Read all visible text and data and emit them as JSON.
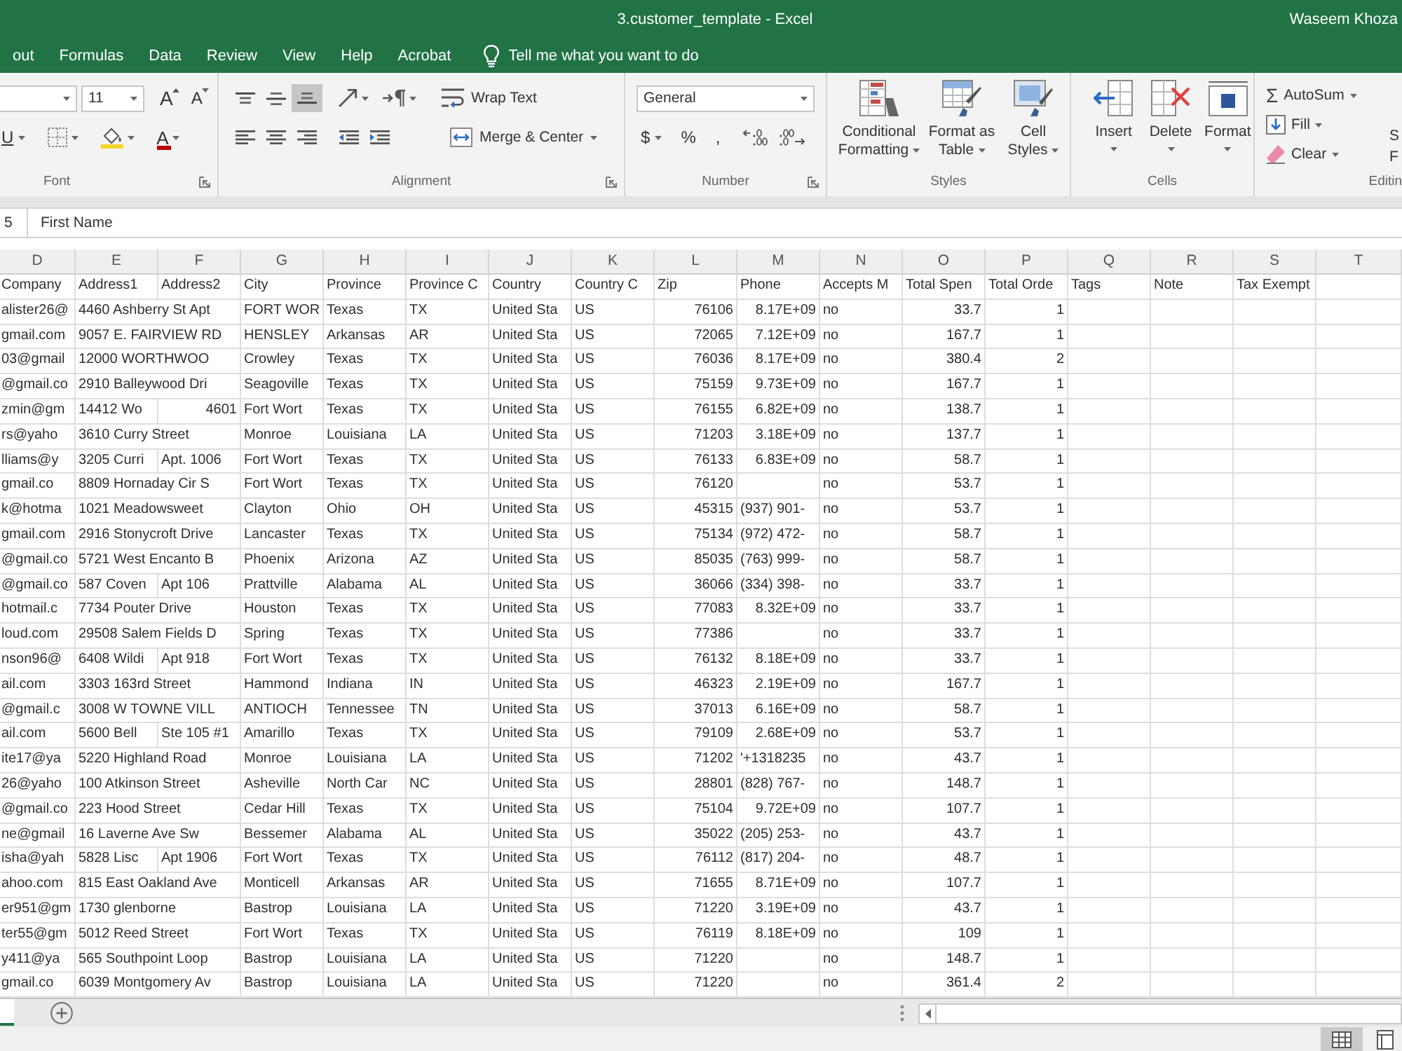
{
  "window": {
    "title": "3.customer_template - Excel",
    "user": "Waseem Khoza"
  },
  "tabs": [
    {
      "label": "out",
      "selected": false
    },
    {
      "label": "Formulas",
      "selected": false
    },
    {
      "label": "Data",
      "selected": false
    },
    {
      "label": "Review",
      "selected": false
    },
    {
      "label": "View",
      "selected": false
    },
    {
      "label": "Help",
      "selected": false
    },
    {
      "label": "Acrobat",
      "selected": false
    }
  ],
  "tell_me": {
    "placeholder": "Tell me what you want to do"
  },
  "ribbon": {
    "font": {
      "label": "Font",
      "size": "11",
      "grow": "A",
      "shrink": "A",
      "underline": "U",
      "font_color": "A"
    },
    "alignment": {
      "label": "Alignment",
      "vertical_align": [
        {
          "selected": false
        },
        {
          "selected": false
        },
        {
          "selected": true
        }
      ],
      "wrap_text": "Wrap Text",
      "merge": "Merge & Center"
    },
    "number": {
      "label": "Number",
      "format": "General",
      "currency": "$",
      "percent": "%",
      "comma": ","
    },
    "styles": {
      "label": "Styles",
      "buttons": [
        {
          "label": "Conditional Formatting"
        },
        {
          "label": "Format as Table"
        },
        {
          "label": "Cell Styles"
        }
      ]
    },
    "cells": {
      "label": "Cells",
      "buttons": [
        {
          "label": "Insert"
        },
        {
          "label": "Delete"
        },
        {
          "label": "Format"
        }
      ]
    },
    "editing": {
      "label": "Editin",
      "sigma": "Σ",
      "autosum": "AutoSum",
      "fill": "Fill",
      "clear": "Clear",
      "cut_button": {
        "lines": [
          "S",
          "F"
        ]
      }
    }
  },
  "formula_bar": {
    "name_box": "5",
    "content": "First Name"
  },
  "sheet": {
    "column_letters": [
      "D",
      "E",
      "F",
      "G",
      "H",
      "I",
      "J",
      "K",
      "L",
      "M",
      "N",
      "O",
      "P",
      "Q",
      "R",
      "S",
      "T"
    ],
    "rows": [
      {
        "text": {
          "d": "Company",
          "e": "Address1",
          "f": "Address2",
          "g": "City",
          "h": "Province",
          "i": "Province C",
          "j": "Country",
          "k": "Country C",
          "l": "Zip",
          "m": "Phone",
          "n": "Accepts M",
          "o": "Total Spen",
          "p": "Total Orde",
          "q": "Tags",
          "r": "Note",
          "s": "Tax Exempt"
        }
      },
      {
        "text": {
          "d": "alister26@",
          "e": "4460 Ashberry St Apt",
          "g": "FORT WOR",
          "h": "Texas",
          "i": "TX",
          "j": "United Sta",
          "k": "US",
          "n": "no"
        },
        "number": {
          "l": "76106",
          "m": "8.17E+09",
          "o": "33.7",
          "p": "1"
        }
      },
      {
        "text": {
          "d": "gmail.com",
          "e": "9057 E. FAIRVIEW RD",
          "g": "HENSLEY",
          "h": "Arkansas",
          "i": "AR",
          "j": "United Sta",
          "k": "US",
          "n": "no"
        },
        "number": {
          "l": "72065",
          "m": "7.12E+09",
          "o": "167.7",
          "p": "1"
        }
      },
      {
        "text": {
          "d": "03@gmail",
          "e": "12000 WORTHWOO",
          "g": "Crowley",
          "h": "Texas",
          "i": "TX",
          "j": "United Sta",
          "k": "US",
          "n": "no"
        },
        "number": {
          "l": "76036",
          "m": "8.17E+09",
          "o": "380.4",
          "p": "2"
        }
      },
      {
        "text": {
          "d": "@gmail.co",
          "e": "2910 Balleywood Dri",
          "g": "Seagoville",
          "h": "Texas",
          "i": "TX",
          "j": "United Sta",
          "k": "US",
          "n": "no"
        },
        "number": {
          "l": "75159",
          "m": "9.73E+09",
          "o": "167.7",
          "p": "1"
        }
      },
      {
        "text": {
          "d": "zmin@gm",
          "e": "14412 Wo",
          "g": "Fort Wort",
          "h": "Texas",
          "i": "TX",
          "j": "United Sta",
          "k": "US",
          "n": "no"
        },
        "number": {
          "f": "4601",
          "l": "76155",
          "m": "6.82E+09",
          "o": "138.7",
          "p": "1"
        }
      },
      {
        "text": {
          "d": "rs@yaho",
          "e": "3610 Curry Street",
          "g": "Monroe",
          "h": "Louisiana",
          "i": "LA",
          "j": "United Sta",
          "k": "US",
          "n": "no"
        },
        "number": {
          "l": "71203",
          "m": "3.18E+09",
          "o": "137.7",
          "p": "1"
        }
      },
      {
        "text": {
          "d": "lliams@y",
          "e": "3205 Curri",
          "f": "Apt. 1006",
          "g": "Fort Wort",
          "h": "Texas",
          "i": "TX",
          "j": "United Sta",
          "k": "US",
          "n": "no"
        },
        "number": {
          "l": "76133",
          "m": "6.83E+09",
          "o": "58.7",
          "p": "1"
        }
      },
      {
        "text": {
          "d": "gmail.co",
          "e": "8809 Hornaday Cir S",
          "g": "Fort Wort",
          "h": "Texas",
          "i": "TX",
          "j": "United Sta",
          "k": "US",
          "n": "no"
        },
        "number": {
          "l": "76120",
          "o": "53.7",
          "p": "1"
        }
      },
      {
        "text": {
          "d": "k@hotma",
          "e": "1021 Meadowsweet",
          "g": "Clayton",
          "h": "Ohio",
          "i": "OH",
          "j": "United Sta",
          "k": "US",
          "m": "(937) 901-",
          "n": "no"
        },
        "number": {
          "l": "45315",
          "o": "53.7",
          "p": "1"
        }
      },
      {
        "text": {
          "d": "gmail.com",
          "e": "2916 Stonycroft Drive",
          "g": "Lancaster",
          "h": "Texas",
          "i": "TX",
          "j": "United Sta",
          "k": "US",
          "m": "(972) 472-",
          "n": "no"
        },
        "number": {
          "l": "75134",
          "o": "58.7",
          "p": "1"
        }
      },
      {
        "text": {
          "d": "@gmail.co",
          "e": "5721 West Encanto B",
          "g": "Phoenix",
          "h": "Arizona",
          "i": "AZ",
          "j": "United Sta",
          "k": "US",
          "m": "(763) 999-",
          "n": "no"
        },
        "number": {
          "l": "85035",
          "o": "58.7",
          "p": "1"
        }
      },
      {
        "text": {
          "d": "@gmail.co",
          "e": "587 Coven",
          "f": "Apt 106",
          "g": "Prattville",
          "h": "Alabama",
          "i": "AL",
          "j": "United Sta",
          "k": "US",
          "m": "(334) 398-",
          "n": "no"
        },
        "number": {
          "l": "36066",
          "o": "33.7",
          "p": "1"
        }
      },
      {
        "text": {
          "d": "hotmail.c",
          "e": "7734 Pouter Drive",
          "g": "Houston",
          "h": "Texas",
          "i": "TX",
          "j": "United Sta",
          "k": "US",
          "n": "no"
        },
        "number": {
          "l": "77083",
          "m": "8.32E+09",
          "o": "33.7",
          "p": "1"
        }
      },
      {
        "text": {
          "d": "loud.com",
          "e": "29508 Salem Fields D",
          "g": "Spring",
          "h": "Texas",
          "i": "TX",
          "j": "United Sta",
          "k": "US",
          "n": "no"
        },
        "number": {
          "l": "77386",
          "o": "33.7",
          "p": "1"
        }
      },
      {
        "text": {
          "d": "nson96@",
          "e": "6408 Wildi",
          "f": "Apt 918",
          "g": "Fort Wort",
          "h": "Texas",
          "i": "TX",
          "j": "United Sta",
          "k": "US",
          "n": "no"
        },
        "number": {
          "l": "76132",
          "m": "8.18E+09",
          "o": "33.7",
          "p": "1"
        }
      },
      {
        "text": {
          "d": "ail.com",
          "e": "3303 163rd Street",
          "g": "Hammond",
          "h": "Indiana",
          "i": "IN",
          "j": "United Sta",
          "k": "US",
          "n": "no"
        },
        "number": {
          "l": "46323",
          "m": "2.19E+09",
          "o": "167.7",
          "p": "1"
        }
      },
      {
        "text": {
          "d": "@gmail.c",
          "e": "3008 W TOWNE VILL",
          "g": "ANTIOCH",
          "h": "Tennessee",
          "i": "TN",
          "j": "United Sta",
          "k": "US",
          "n": "no"
        },
        "number": {
          "l": "37013",
          "m": "6.16E+09",
          "o": "58.7",
          "p": "1"
        }
      },
      {
        "text": {
          "d": "ail.com",
          "e": "5600 Bell",
          "f": "Ste 105 #1",
          "g": "Amarillo",
          "h": "Texas",
          "i": "TX",
          "j": "United Sta",
          "k": "US",
          "n": "no"
        },
        "number": {
          "l": "79109",
          "m": "2.68E+09",
          "o": "53.7",
          "p": "1"
        }
      },
      {
        "text": {
          "d": "ite17@ya",
          "e": "5220 Highland Road",
          "g": "Monroe",
          "h": "Louisiana",
          "i": "LA",
          "j": "United Sta",
          "k": "US",
          "m": "'+1318235",
          "n": "no"
        },
        "number": {
          "l": "71202",
          "o": "43.7",
          "p": "1"
        }
      },
      {
        "text": {
          "d": "26@yaho",
          "e": "100 Atkinson Street",
          "g": "Asheville",
          "h": "North Car",
          "i": "NC",
          "j": "United Sta",
          "k": "US",
          "m": "(828) 767-",
          "n": "no"
        },
        "number": {
          "l": "28801",
          "o": "148.7",
          "p": "1"
        }
      },
      {
        "text": {
          "d": "@gmail.co",
          "e": "223 Hood Street",
          "g": "Cedar Hill",
          "h": "Texas",
          "i": "TX",
          "j": "United Sta",
          "k": "US",
          "n": "no"
        },
        "number": {
          "l": "75104",
          "m": "9.72E+09",
          "o": "107.7",
          "p": "1"
        }
      },
      {
        "text": {
          "d": "ne@gmail",
          "e": "16 Laverne Ave Sw",
          "g": "Bessemer",
          "h": "Alabama",
          "i": "AL",
          "j": "United Sta",
          "k": "US",
          "m": "(205) 253-",
          "n": "no"
        },
        "number": {
          "l": "35022",
          "o": "43.7",
          "p": "1"
        }
      },
      {
        "text": {
          "d": "isha@yah",
          "e": "5828 Lisc",
          "f": "Apt 1906",
          "g": "Fort Wort",
          "h": "Texas",
          "i": "TX",
          "j": "United Sta",
          "k": "US",
          "m": "(817) 204-",
          "n": "no"
        },
        "number": {
          "l": "76112",
          "o": "48.7",
          "p": "1"
        }
      },
      {
        "text": {
          "d": "ahoo.com",
          "e": "815 East Oakland Ave",
          "g": "Monticell",
          "h": "Arkansas",
          "i": "AR",
          "j": "United Sta",
          "k": "US",
          "n": "no"
        },
        "number": {
          "l": "71655",
          "m": "8.71E+09",
          "o": "107.7",
          "p": "1"
        }
      },
      {
        "text": {
          "d": "er951@gm",
          "e": "1730 glenborne",
          "g": "Bastrop",
          "h": "Louisiana",
          "i": "LA",
          "j": "United Sta",
          "k": "US",
          "n": "no"
        },
        "number": {
          "l": "71220",
          "m": "3.19E+09",
          "o": "43.7",
          "p": "1"
        }
      },
      {
        "text": {
          "d": "ter55@gm",
          "e": "5012 Reed Street",
          "g": "Fort Wort",
          "h": "Texas",
          "i": "TX",
          "j": "United Sta",
          "k": "US",
          "n": "no"
        },
        "number": {
          "l": "76119",
          "m": "8.18E+09",
          "o": "109",
          "p": "1"
        }
      },
      {
        "text": {
          "d": "y411@ya",
          "e": "565 Southpoint Loop",
          "g": "Bastrop",
          "h": "Louisiana",
          "i": "LA",
          "j": "United Sta",
          "k": "US",
          "n": "no"
        },
        "number": {
          "l": "71220",
          "o": "148.7",
          "p": "1"
        }
      },
      {
        "text": {
          "d": "gmail.co",
          "e": "6039 Montgomery Av",
          "g": "Bastrop",
          "h": "Louisiana",
          "i": "LA",
          "j": "United Sta",
          "k": "US",
          "n": "no"
        },
        "number": {
          "l": "71220",
          "o": "361.4",
          "p": "2"
        }
      }
    ]
  },
  "sheet_tabs": [
    {
      "selected": true
    }
  ],
  "status_bar": {
    "views": [
      {
        "selected": true
      },
      {
        "selected": false
      }
    ]
  }
}
